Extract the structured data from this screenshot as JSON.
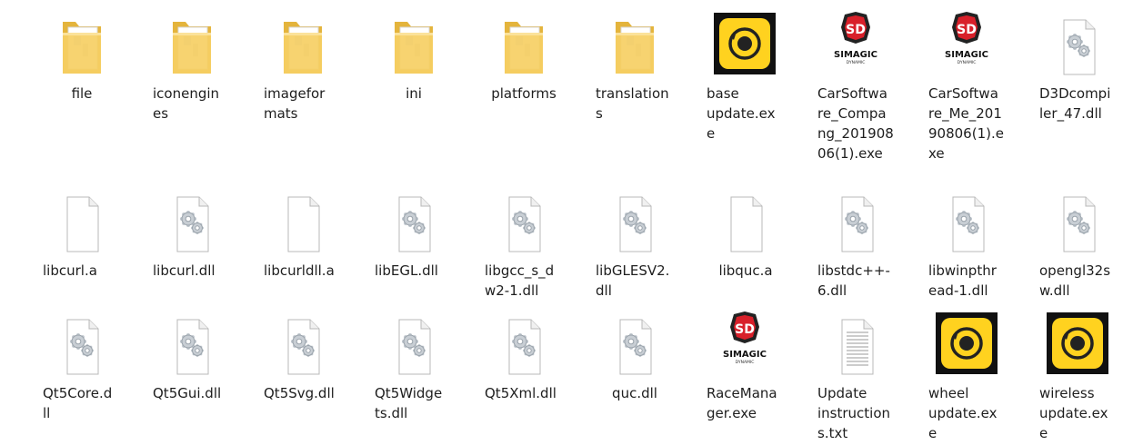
{
  "files": [
    {
      "name": "file",
      "icon": "folder-icon"
    },
    {
      "name": "iconengines",
      "icon": "folder-icon"
    },
    {
      "name": "imageformats",
      "icon": "folder-icon"
    },
    {
      "name": "ini",
      "icon": "folder-icon"
    },
    {
      "name": "platforms",
      "icon": "folder-icon"
    },
    {
      "name": "translations",
      "icon": "folder-icon"
    },
    {
      "name": "base update.exe",
      "icon": "update-app-icon"
    },
    {
      "name": "CarSoftware_Compang_20190806(1).exe",
      "icon": "simagic-logo-icon"
    },
    {
      "name": "CarSoftware_Me_20190806(1).exe",
      "icon": "simagic-logo-icon"
    },
    {
      "name": "D3Dcompiler_47.dll",
      "icon": "dll-gear-icon"
    },
    {
      "name": "libcurl.a",
      "icon": "blank-file-icon"
    },
    {
      "name": "libcurl.dll",
      "icon": "dll-gear-icon"
    },
    {
      "name": "libcurldll.a",
      "icon": "blank-file-icon"
    },
    {
      "name": "libEGL.dll",
      "icon": "dll-gear-icon"
    },
    {
      "name": "libgcc_s_dw2-1.dll",
      "icon": "dll-gear-icon"
    },
    {
      "name": "libGLESV2.dll",
      "icon": "dll-gear-icon"
    },
    {
      "name": "libquc.a",
      "icon": "blank-file-icon"
    },
    {
      "name": "libstdc++-6.dll",
      "icon": "dll-gear-icon"
    },
    {
      "name": "libwinpthread-1.dll",
      "icon": "dll-gear-icon"
    },
    {
      "name": "opengl32sw.dll",
      "icon": "dll-gear-icon"
    },
    {
      "name": "Qt5Core.dll",
      "icon": "dll-gear-icon"
    },
    {
      "name": "Qt5Gui.dll",
      "icon": "dll-gear-icon"
    },
    {
      "name": "Qt5Svg.dll",
      "icon": "dll-gear-icon"
    },
    {
      "name": "Qt5Widgets.dll",
      "icon": "dll-gear-icon"
    },
    {
      "name": "Qt5Xml.dll",
      "icon": "dll-gear-icon"
    },
    {
      "name": "quc.dll",
      "icon": "dll-gear-icon"
    },
    {
      "name": "RaceManager.exe",
      "icon": "simagic-logo-icon"
    },
    {
      "name": "Update instructions.txt",
      "icon": "text-file-icon"
    },
    {
      "name": "wheel update.exe",
      "icon": "update-app-icon"
    },
    {
      "name": "wireless update.exe",
      "icon": "update-app-icon"
    }
  ],
  "brand": {
    "logo_text": "SIMAGIC",
    "logo_subtext": "DYNAMIC",
    "logo_mark": "SD"
  },
  "colors": {
    "folder": "#f6cf64",
    "folder_dark": "#e4b43c",
    "update_bg": "#111111",
    "update_yellow": "#ffd21f",
    "simagic_red": "#d8202a"
  }
}
